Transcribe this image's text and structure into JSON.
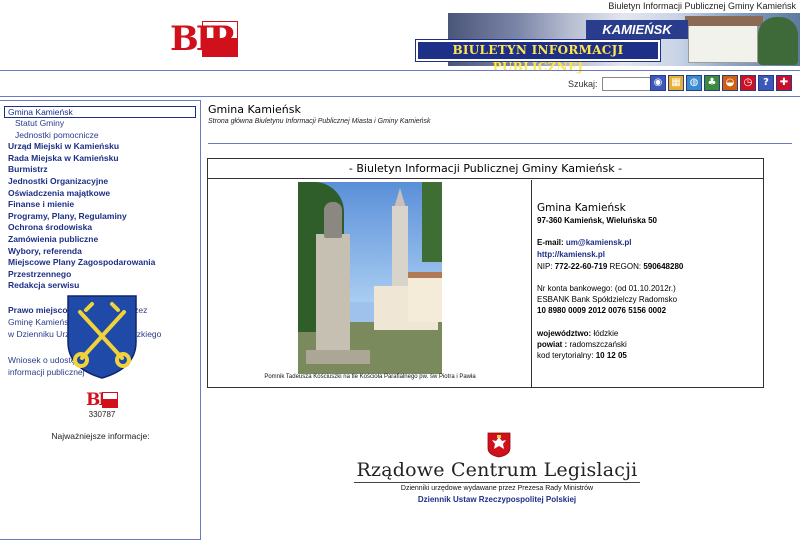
{
  "window_title": "Biuletyn Informacji Publicznej Gminy Kamieńsk",
  "logo": {
    "text": "BIP"
  },
  "banner": {
    "city": "KAMIEŃSK",
    "bip_title": "BIULETYN INFORMACJI PUBLICZNEJ"
  },
  "search": {
    "label": "Szukaj:",
    "value": ""
  },
  "toolbar_icons": [
    "eye-icon",
    "map-icon",
    "globe-icon",
    "tree-icon",
    "rss-icon",
    "clock-icon",
    "help-icon",
    "uk-flag-icon"
  ],
  "sidebar": {
    "items": [
      {
        "label": "Gmina Kamieńsk",
        "kind": "selected"
      },
      {
        "label": "Statut Gminy",
        "kind": "sub"
      },
      {
        "label": "Jednostki pomocnicze",
        "kind": "sub"
      },
      {
        "label": "Urząd Miejski w Kamieńsku",
        "kind": "main"
      },
      {
        "label": "Rada Miejska w Kamieńsku",
        "kind": "main"
      },
      {
        "label": "Burmistrz",
        "kind": "main"
      },
      {
        "label": "Jednostki Organizacyjne",
        "kind": "main"
      },
      {
        "label": "Oświadczenia majątkowe",
        "kind": "main"
      },
      {
        "label": "Finanse i mienie",
        "kind": "main"
      },
      {
        "label": "Programy, Plany, Regulaminy",
        "kind": "main"
      },
      {
        "label": "Ochrona środowiska",
        "kind": "main"
      },
      {
        "label": "Zamówienia publiczne",
        "kind": "main"
      },
      {
        "label": "Wybory, referenda",
        "kind": "main"
      },
      {
        "label": "Miejscowe Plany Zagospodarowania",
        "kind": "main"
      },
      {
        "label": "Przestrzennego",
        "kind": "main"
      },
      {
        "label": "Redakcja serwisu",
        "kind": "main"
      }
    ],
    "law_bold": "Prawo miejscowe",
    "law_line1": "stanowione przez",
    "law_line2": "Gminę Kamieńsk i publikowane",
    "law_line3": "w Dzienniku Urzędowym Woj. Łódzkiego",
    "wniosek_line1": "Wniosek o udostępnienie",
    "wniosek_line2": "informacji publicznej",
    "counter": "330787",
    "latest_label": "Najważniejsze informacje:"
  },
  "main": {
    "title": "Gmina Kamieńsk",
    "subtitle": "Strona główna Biuletynu Informacji Publicznej Miasta i Gminy Kamieńsk",
    "table_header": "- Biuletyn Informacji Publicznej Gminy Kamieńsk -",
    "photo_caption": "Pomnik Tadeusza Kościuszki na tle Kościoła Parafialnego pw. św Piotra i Pawła",
    "office": {
      "name": "Gmina Kamieńsk",
      "address": "97-360 Kamieńsk, Wieluńska 50",
      "email_label": "E-mail:",
      "email": "um@kamiensk.pl",
      "website": "http://kamiensk.pl",
      "nip_label": "NIP:",
      "nip": "772-22-60-719",
      "regon_label": "REGON:",
      "regon": "590648280",
      "bank_label": "Nr konta bankowego: (od 01.10.2012r.)",
      "bank_name": "ESBANK Bank Spółdzielczy Radomsko",
      "account": "10 8980 0009 2012 0076 5156 0002",
      "voiv_label": "województwo:",
      "voiv": "łódzkie",
      "county_label": "powiat :",
      "county": "radomszczański",
      "terr_label": "kod terytorialny:",
      "terr": "10 12 05"
    }
  },
  "footer": {
    "rcl_title": "Rządowe Centrum Legislacji",
    "rcl_sub": "Dzienniki urzędowe wydawane przez Prezesa Rady Ministrów",
    "rcl_link": "Dziennik Ustaw Rzeczypospolitej Polskiej"
  }
}
